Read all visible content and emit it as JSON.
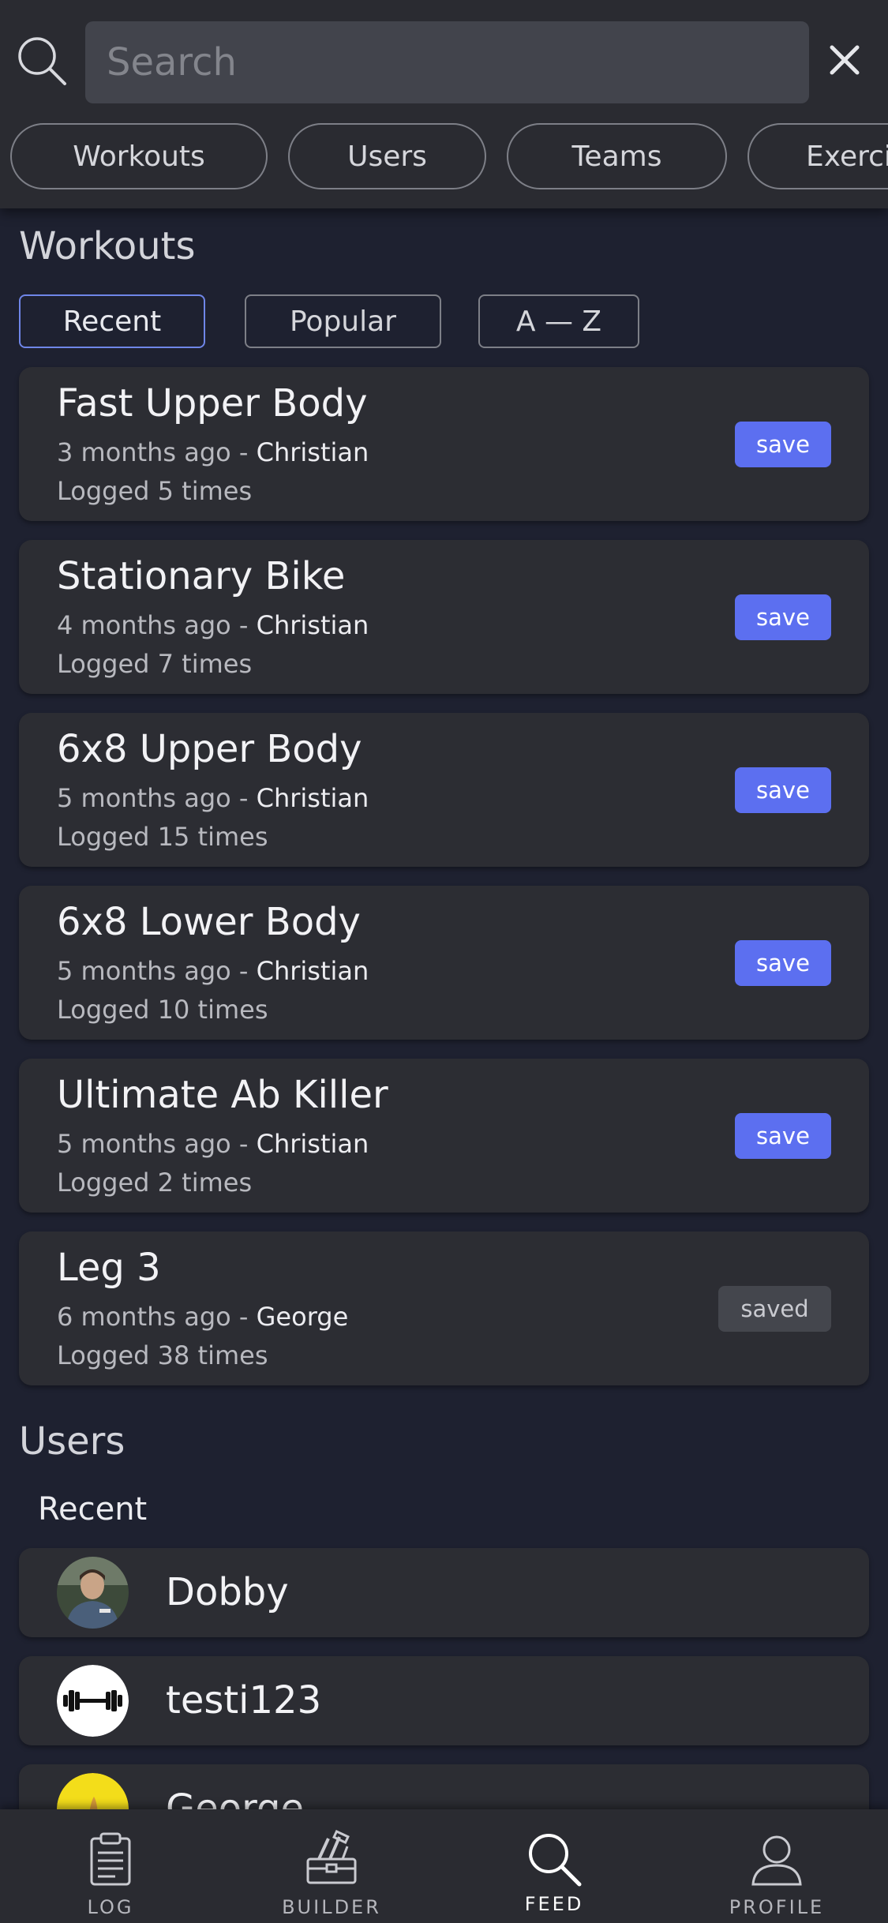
{
  "search": {
    "placeholder": "Search"
  },
  "categories": [
    "Workouts",
    "Users",
    "Teams",
    "Exercises"
  ],
  "workouts_section": {
    "title": "Workouts",
    "sort_tabs": [
      "Recent",
      "Popular",
      "A — Z"
    ],
    "active_sort": "Recent",
    "items": [
      {
        "title": "Fast Upper Body",
        "age": "3 months ago",
        "sep": "-",
        "author": "Christian",
        "logged": "Logged 5 times",
        "action": "save"
      },
      {
        "title": "Stationary Bike",
        "age": "4 months ago",
        "sep": "-",
        "author": "Christian",
        "logged": "Logged 7 times",
        "action": "save"
      },
      {
        "title": "6x8 Upper Body",
        "age": "5 months ago",
        "sep": "-",
        "author": "Christian",
        "logged": "Logged 15 times",
        "action": "save"
      },
      {
        "title": "6x8 Lower Body",
        "age": "5 months ago",
        "sep": "-",
        "author": "Christian",
        "logged": "Logged 10 times",
        "action": "save"
      },
      {
        "title": "Ultimate Ab Killer",
        "age": "5 months ago",
        "sep": "-",
        "author": "Christian",
        "logged": "Logged 2 times",
        "action": "save"
      },
      {
        "title": "Leg 3",
        "age": "6 months ago",
        "sep": "-",
        "author": "George",
        "logged": "Logged 38 times",
        "action": "saved"
      }
    ]
  },
  "users_section": {
    "title": "Users",
    "subtitle": "Recent",
    "users": [
      {
        "name": "Dobby",
        "avatar": "photo-avatar"
      },
      {
        "name": "testi123",
        "avatar": "dumbbell-avatar"
      },
      {
        "name": "George",
        "avatar": "yellow-avatar"
      }
    ]
  },
  "nav": {
    "items": [
      {
        "label": "LOG",
        "icon": "clipboard-icon"
      },
      {
        "label": "BUILDER",
        "icon": "toolbox-icon"
      },
      {
        "label": "FEED",
        "icon": "search-icon"
      },
      {
        "label": "PROFILE",
        "icon": "person-icon"
      }
    ],
    "active": "FEED"
  },
  "colors": {
    "background": "#1e2130",
    "surface": "#2c2d33",
    "accent": "#5c6ff0",
    "active_border": "#6f86e8"
  }
}
